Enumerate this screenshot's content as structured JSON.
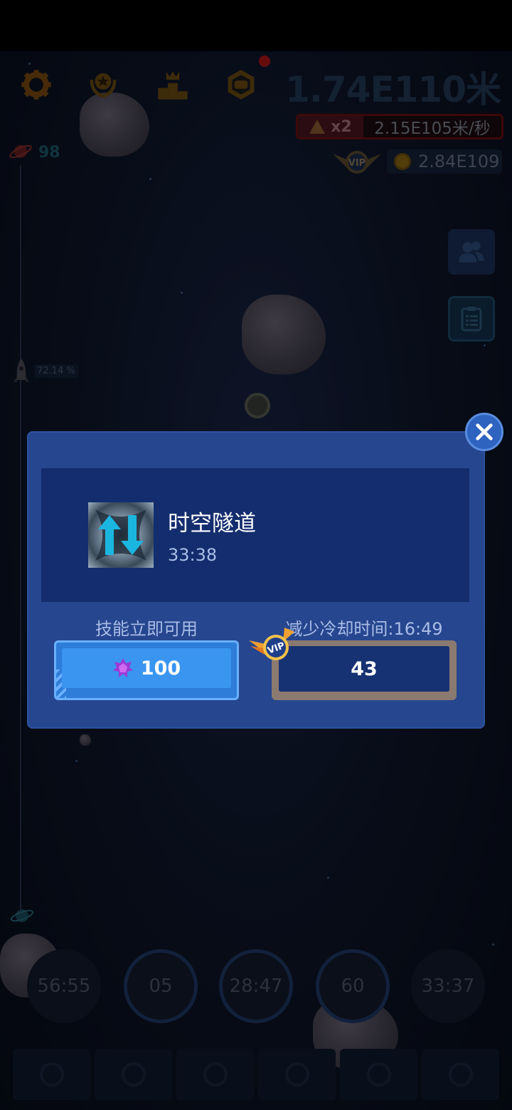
{
  "hud": {
    "distance": "1.74E110米",
    "speed_multiplier": "x2",
    "speed_rate": "2.15E105米/秒",
    "vip_label": "VIP",
    "coins": "2.84E109",
    "planet_count": "98",
    "progress_percent": "72.14 %"
  },
  "icons": {
    "settings": "gear-icon",
    "achievements": "laurel-icon",
    "ranking": "podium-icon",
    "chat": "chat-hexagon-icon",
    "friends": "friends-icon",
    "tasks": "clipboard-icon"
  },
  "timers": [
    "56:55",
    "05",
    "28:47",
    "60",
    "33:37"
  ],
  "dialog": {
    "skill_name": "时空隧道",
    "skill_cooldown": "33:38",
    "instant_label": "技能立即可用",
    "instant_cost": "100",
    "reduce_label": "减少冷却时间:16:49",
    "reduce_cost": "43",
    "vip_label": "VIP"
  },
  "colors": {
    "dialog_bg": "#26468f",
    "dialog_inner": "#132d6e",
    "accent_blue": "#3a95f0",
    "close_blue": "#2e63c0"
  }
}
